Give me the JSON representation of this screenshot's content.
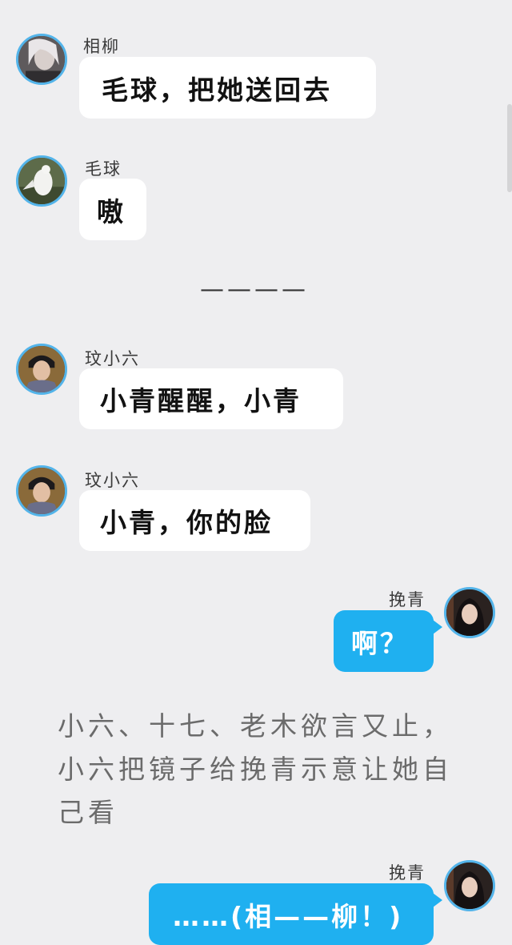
{
  "messages": [
    {
      "sender": "相柳",
      "text": "毛球，把她送回去",
      "avatar_icon": "xiangliu-avatar"
    },
    {
      "sender": "毛球",
      "text": "嗷",
      "avatar_icon": "white-eagle-avatar"
    },
    {
      "sender": "玟小六",
      "text": "小青醒醒，小青",
      "avatar_icon": "wenxiaoliu-avatar"
    },
    {
      "sender": "玟小六",
      "text": "小青，你的脸",
      "avatar_icon": "wenxiaoliu-avatar"
    },
    {
      "sender": "挽青",
      "text": "啊？",
      "avatar_icon": "wanqing-avatar"
    },
    {
      "sender": "挽青",
      "text": "……(相——柳！)",
      "avatar_icon": "wanqing-avatar"
    }
  ],
  "divider": "————",
  "narration": "小六、十七、老木欲言又止，小六把镜子给挽青示意让她自己看",
  "colors": {
    "background": "#eeeef0",
    "incoming_bubble": "#ffffff",
    "outgoing_bubble": "#1fb0f0",
    "avatar_ring": "#53b4ea"
  }
}
